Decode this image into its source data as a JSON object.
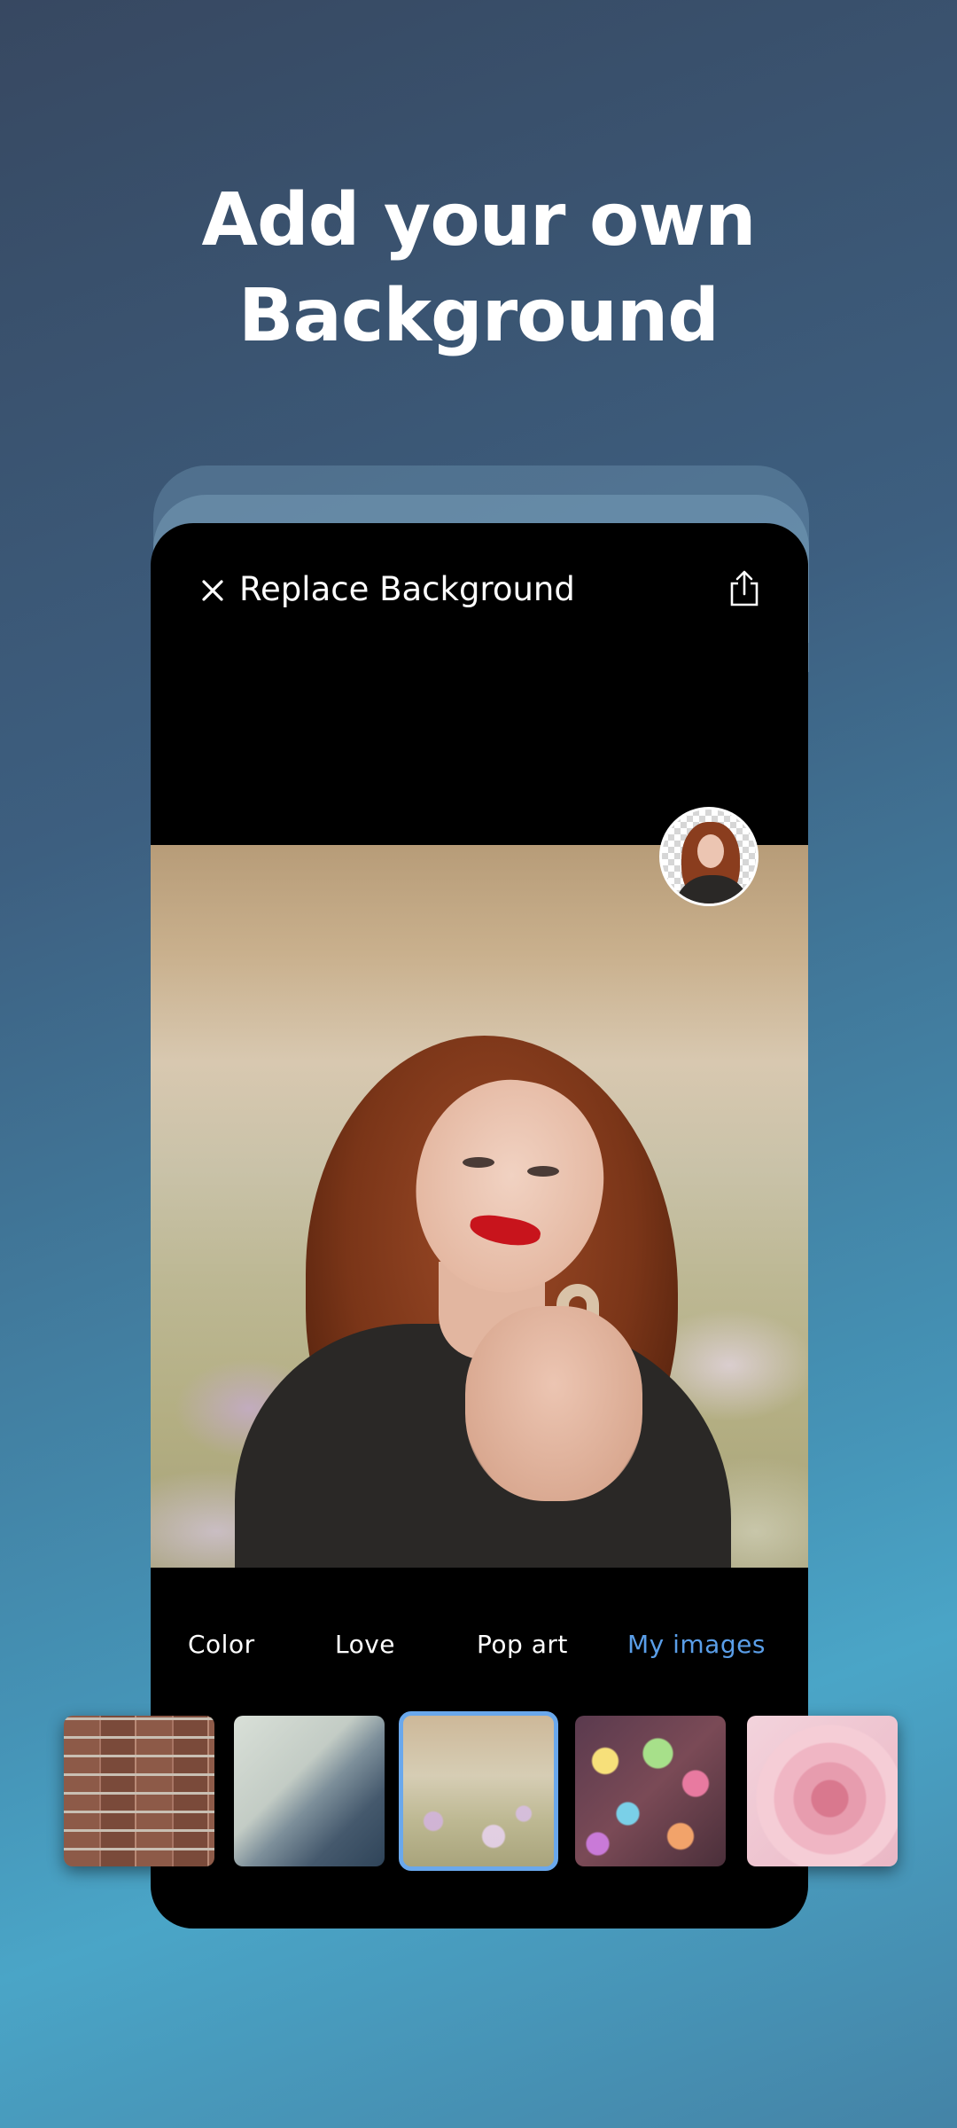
{
  "headline": {
    "line1": "Add your own",
    "line2": "Background"
  },
  "topbar": {
    "title": "Replace Background",
    "close_icon": "close-icon",
    "share_icon": "share-icon"
  },
  "tabs": [
    {
      "label": "Color",
      "active": false
    },
    {
      "label": "Love",
      "active": false
    },
    {
      "label": "Pop art",
      "active": false
    },
    {
      "label": "My images",
      "active": true
    }
  ],
  "colors": {
    "accent": "#5a9ee8",
    "selected_border": "#6aa8ec",
    "phone_bg": "#000000"
  },
  "backgrounds": [
    {
      "name": "brick-wall"
    },
    {
      "name": "paper-curl"
    },
    {
      "name": "flower-field",
      "selected": true
    },
    {
      "name": "bokeh-lights"
    },
    {
      "name": "pink-rose"
    }
  ]
}
